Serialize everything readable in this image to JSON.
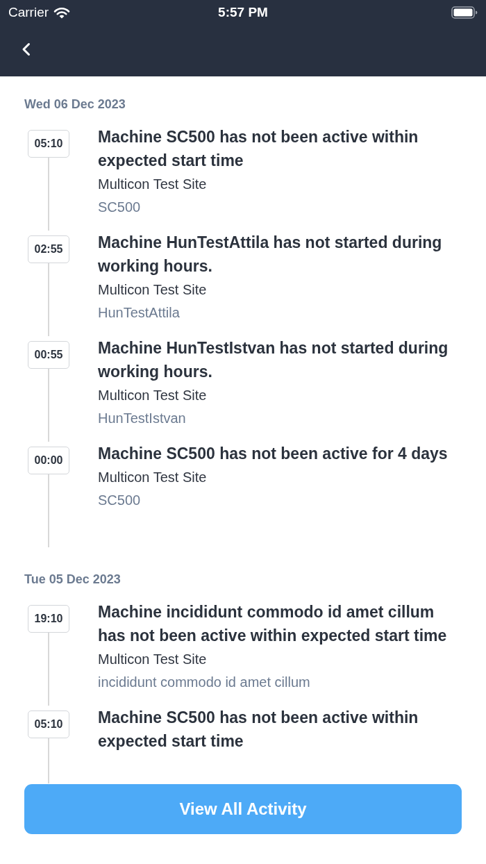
{
  "status_bar": {
    "carrier": "Carrier",
    "time": "5:57 PM"
  },
  "activity": [
    {
      "date": "Wed 06 Dec 2023",
      "events": [
        {
          "time": "05:10",
          "title": "Machine SC500 has not been active within expected start time",
          "site": "Multicon Test Site",
          "machine": "SC500"
        },
        {
          "time": "02:55",
          "title": "Machine HunTestAttila has not started during working hours.",
          "site": "Multicon Test Site",
          "machine": "HunTestAttila"
        },
        {
          "time": "00:55",
          "title": "Machine HunTestIstvan has not started during working hours.",
          "site": "Multicon Test Site",
          "machine": "HunTestIstvan"
        },
        {
          "time": "00:00",
          "title": "Machine SC500 has not been active for 4 days",
          "site": "Multicon Test Site",
          "machine": "SC500"
        }
      ]
    },
    {
      "date": "Tue 05 Dec 2023",
      "events": [
        {
          "time": "19:10",
          "title": "Machine incididunt commodo id amet cillum has not been active within expected start time",
          "site": "Multicon Test Site",
          "machine": "incididunt commodo id amet cillum"
        },
        {
          "time": "05:10",
          "title": "Machine SC500 has not been active within expected start time"
        }
      ]
    }
  ],
  "footer": {
    "button": "View All Activity"
  }
}
